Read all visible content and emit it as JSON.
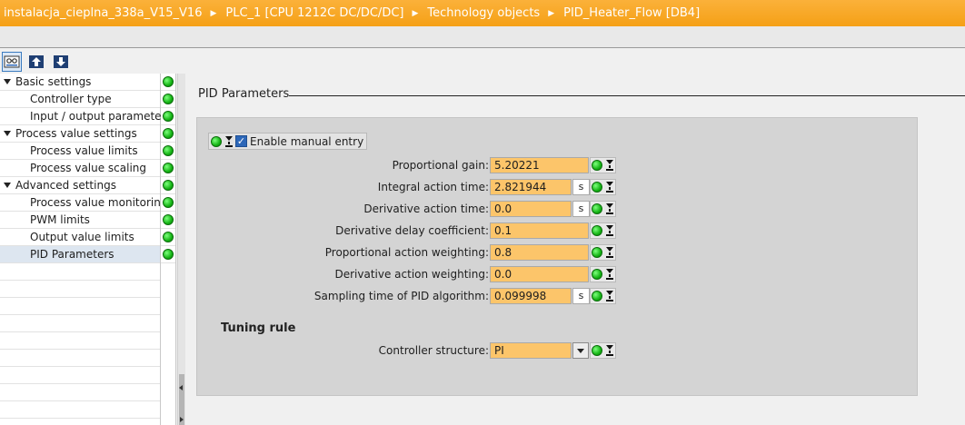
{
  "breadcrumb": {
    "items": [
      "instalacja_cieplna_338a_V15_V16",
      "PLC_1 [CPU 1212C DC/DC/DC]",
      "Technology objects",
      "PID_Heater_Flow [DB4]"
    ],
    "separator": "▶"
  },
  "toolbar": {
    "buttons": [
      "functional-view-icon",
      "upload-icon",
      "download-icon"
    ]
  },
  "nav": {
    "items": [
      {
        "label": "Basic settings",
        "level": 0,
        "expanded": true
      },
      {
        "label": "Controller type",
        "level": 1
      },
      {
        "label": "Input / output parameters",
        "level": 1
      },
      {
        "label": "Process value settings",
        "level": 0,
        "expanded": true
      },
      {
        "label": "Process value limits",
        "level": 1
      },
      {
        "label": "Process value scaling",
        "level": 1
      },
      {
        "label": "Advanced settings",
        "level": 0,
        "expanded": true
      },
      {
        "label": "Process value monitoring",
        "level": 1
      },
      {
        "label": "PWM limits",
        "level": 1
      },
      {
        "label": "Output value limits",
        "level": 1
      },
      {
        "label": "PID Parameters",
        "level": 1,
        "selected": true
      }
    ]
  },
  "main": {
    "section_title": "PID Parameters",
    "manual_entry": {
      "label": "Enable manual entry",
      "checked": true
    },
    "params": [
      {
        "label": "Proportional gain:",
        "value": "5.20221",
        "unit": ""
      },
      {
        "label": "Integral action time:",
        "value": "2.821944",
        "unit": "s"
      },
      {
        "label": "Derivative action time:",
        "value": "0.0",
        "unit": "s"
      },
      {
        "label": "Derivative delay coefficient:",
        "value": "0.1",
        "unit": ""
      },
      {
        "label": "Proportional action weighting:",
        "value": "0.8",
        "unit": ""
      },
      {
        "label": "Derivative action weighting:",
        "value": "0.0",
        "unit": ""
      },
      {
        "label": "Sampling time of PID algorithm:",
        "value": "0.099998",
        "unit": "s"
      }
    ],
    "tuning_title": "Tuning rule",
    "controller_structure": {
      "label": "Controller structure:",
      "value": "PI"
    }
  },
  "colors": {
    "breadcrumb_bg": "#f9a825",
    "field_bg": "#fcc56a",
    "panel_bg": "#d4d4d4",
    "status_ok": "#14b414"
  }
}
